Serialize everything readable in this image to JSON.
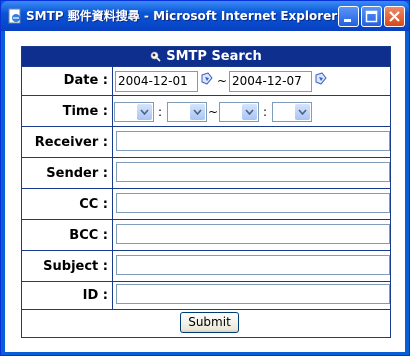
{
  "window": {
    "title": "SMTP 郵件資料搜尋 - Microsoft Internet Explorer"
  },
  "form": {
    "header": "SMTP Search",
    "date_label": "Date :",
    "date_from": "2004-12-01",
    "date_to": "2004-12-07",
    "date_separator": "~",
    "time_label": "Time :",
    "time_colon_1": ":",
    "time_separator": "~",
    "time_colon_2": ":",
    "receiver_label": "Receiver :",
    "sender_label": "Sender :",
    "cc_label": "CC :",
    "bcc_label": "BCC :",
    "subject_label": "Subject :",
    "id_label": "ID :",
    "submit_label": "Submit"
  },
  "colors": {
    "titlebar": "#0a56d6",
    "header_bg": "#0f2f8f",
    "border": "#1a3b8c",
    "input_border": "#7f9db9"
  },
  "icons": {
    "title": "ie-page-icon",
    "header": "search-icon",
    "calendar": "calendar-icon",
    "minimize": "minimize-icon",
    "maximize": "maximize-icon",
    "close": "close-icon"
  }
}
